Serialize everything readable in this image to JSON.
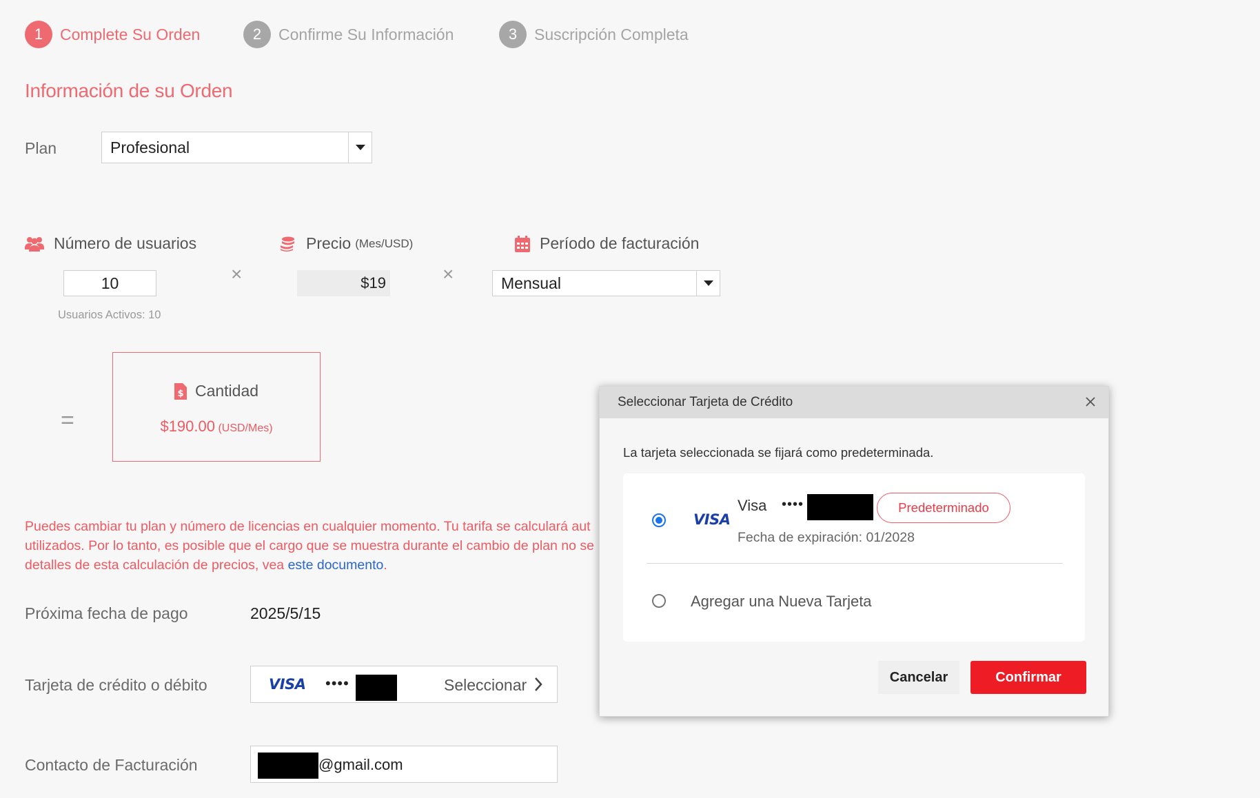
{
  "stepper": {
    "steps": [
      {
        "num": "1",
        "label": "Complete Su Orden"
      },
      {
        "num": "2",
        "label": "Confirme Su Información"
      },
      {
        "num": "3",
        "label": "Suscripción Completa"
      }
    ]
  },
  "order": {
    "title": "Información de su Orden",
    "plan_label": "Plan",
    "plan_value": "Profesional",
    "users_label": "Número de usuarios",
    "users_value": "10",
    "users_active": "Usuarios Activos: 10",
    "price_label": "Precio",
    "price_unit": "(Mes/USD)",
    "price_value": "$19",
    "period_label": "Período de facturación",
    "period_value": "Mensual",
    "times_symbol": "×",
    "equals_symbol": "=",
    "amount_label": "Cantidad",
    "amount_value": "$190.00",
    "amount_unit": "(USD/Mes)"
  },
  "note": {
    "line1": "Puedes cambiar tu plan y número de licencias en cualquier momento. Tu tarifa se calculará aut",
    "line2": "utilizados. Por lo tanto, es posible que el cargo que se muestra durante el cambio de plan no se",
    "line3_prefix": "detalles de esta calculación de precios, vea ",
    "link": "este documento",
    "line3_suffix": "."
  },
  "payment": {
    "next_date_label": "Próxima fecha de pago",
    "next_date_value": "2025/5/15",
    "card_label": "Tarjeta de crédito o débito",
    "card_brand": "VISA",
    "card_dots": "••••",
    "select_label": "Seleccionar",
    "billing_label": "Contacto de Facturación",
    "billing_email_suffix": "@gmail.com"
  },
  "modal": {
    "title": "Seleccionar Tarjeta de Crédito",
    "message": "La tarjeta seleccionada se fijará como predeterminada.",
    "card": {
      "brand_logo": "VISA",
      "name": "Visa",
      "dots": "••••",
      "badge": "Predeterminado",
      "expiry": "Fecha de expiración: 01/2028"
    },
    "add_new": "Agregar una Nueva Tarjeta",
    "cancel": "Cancelar",
    "confirm": "Confirmar"
  },
  "colors": {
    "accent": "#ee6a70",
    "confirm_button": "#ee1c25",
    "radio_selected": "#1a73e8",
    "link": "#2a66c8",
    "visa_blue": "#1a3fa8"
  }
}
